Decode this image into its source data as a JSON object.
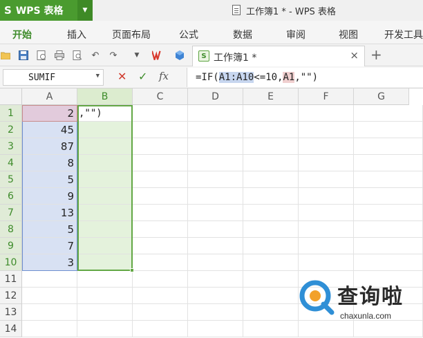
{
  "app": {
    "logo_glyph": "S",
    "name": "WPS 表格",
    "window_title": "工作簿1 * - WPS 表格"
  },
  "ribbon": {
    "tabs": [
      "开始",
      "插入",
      "页面布局",
      "公式",
      "数据",
      "审阅",
      "视图",
      "开发工具"
    ],
    "active_tab": "开始"
  },
  "toolbar": {
    "document_tab": {
      "label": "工作簿1 *",
      "close": "×"
    },
    "new_tab": "+"
  },
  "formula_bar": {
    "name_box": "SUMIF",
    "fx_label": "fx",
    "formula_parts": [
      "=IF(",
      "A1:A10",
      "<=10,",
      "A1",
      ",\"\")"
    ]
  },
  "grid": {
    "columns": [
      "A",
      "B",
      "C",
      "D",
      "E",
      "F",
      "G"
    ],
    "rows": [
      "1",
      "2",
      "3",
      "4",
      "5",
      "6",
      "7",
      "8",
      "9",
      "10",
      "11",
      "12",
      "13",
      "14"
    ],
    "column_a_values": [
      "2",
      "45",
      "87",
      "8",
      "5",
      "9",
      "13",
      "5",
      "7",
      "3"
    ],
    "b1_edit_text": ",\"\")",
    "selected_column": "B",
    "selected_rows": [
      "1",
      "2",
      "3",
      "4",
      "5",
      "6",
      "7",
      "8",
      "9",
      "10"
    ]
  },
  "watermark": {
    "title": "查询啦",
    "url": "chaxunla.com"
  },
  "colors": {
    "brand_green": "#4a9b2f",
    "selection_green": "#62a744",
    "range_blue": "#d8e1f3",
    "range_red": "#e2cbdc"
  }
}
